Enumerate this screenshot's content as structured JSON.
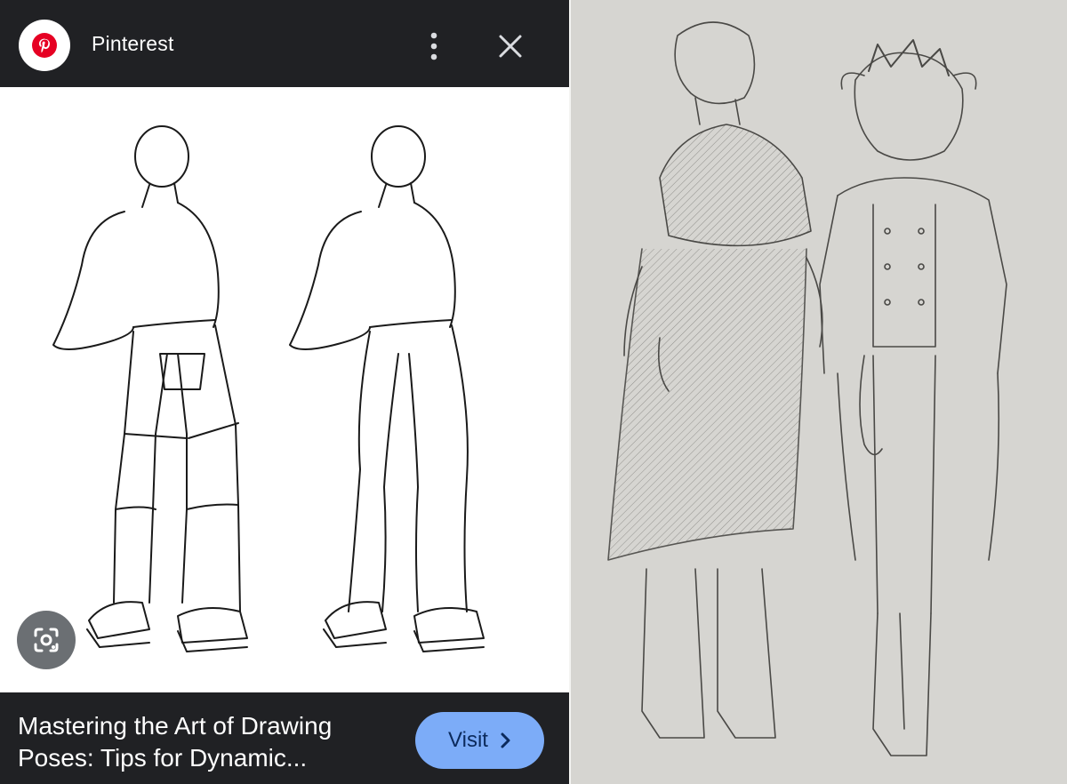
{
  "header": {
    "site_name": "Pinterest",
    "logo_icon": "pinterest-logo-icon",
    "menu_icon": "more-vert-icon",
    "close_icon": "close-icon"
  },
  "preview": {
    "image_description": "pencil-sketch",
    "lens_icon": "google-lens-icon"
  },
  "footer": {
    "title": "Mastering the Art of Drawing Poses: Tips for Dynamic...",
    "visit_label": "Visit",
    "visit_icon": "chevron-right-icon"
  },
  "colors": {
    "bar_bg": "#202124",
    "visit_bg": "#7cacf8",
    "pinterest_red": "#e60023"
  }
}
